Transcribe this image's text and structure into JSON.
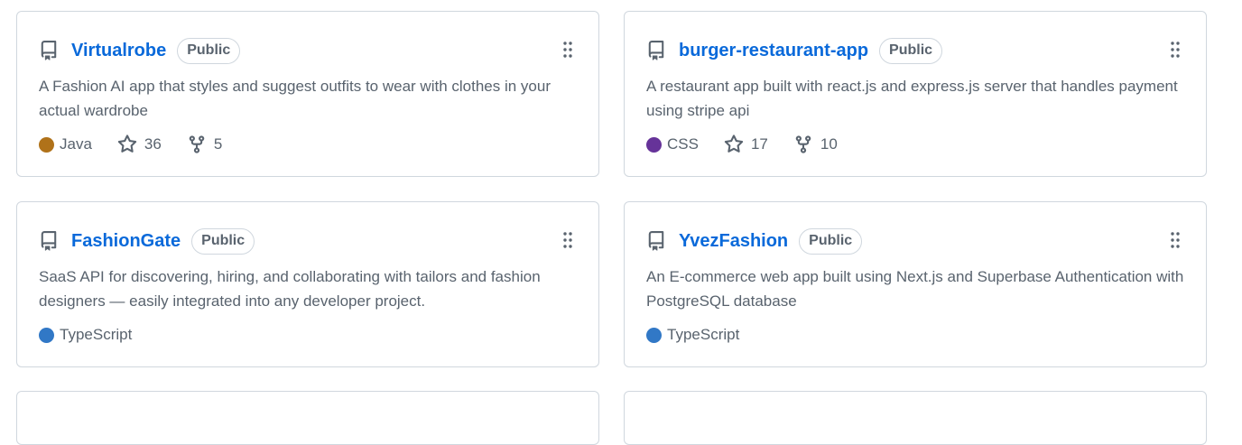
{
  "repos": [
    {
      "name": "Virtualrobe",
      "visibility": "Public",
      "description": "A Fashion AI app that styles and suggest outfits to wear with clothes in your actual wardrobe",
      "language": "Java",
      "language_color": "#b07219",
      "stars": "36",
      "forks": "5"
    },
    {
      "name": "burger-restaurant-app",
      "visibility": "Public",
      "description": "A restaurant app built with react.js and express.js server that handles payment using stripe api",
      "language": "CSS",
      "language_color": "#663399",
      "stars": "17",
      "forks": "10"
    },
    {
      "name": "FashionGate",
      "visibility": "Public",
      "description": "SaaS API for discovering, hiring, and collaborating with tailors and fashion designers — easily integrated into any developer project.",
      "language": "TypeScript",
      "language_color": "#3178c6"
    },
    {
      "name": "YvezFashion",
      "visibility": "Public",
      "description": "An E-commerce web app built using Next.js and Superbase Authentication with PostgreSQL database",
      "language": "TypeScript",
      "language_color": "#3178c6"
    }
  ],
  "icons": {
    "repo": "repo-icon",
    "grip": "grabber-icon",
    "star": "star-icon",
    "fork": "fork-icon"
  }
}
